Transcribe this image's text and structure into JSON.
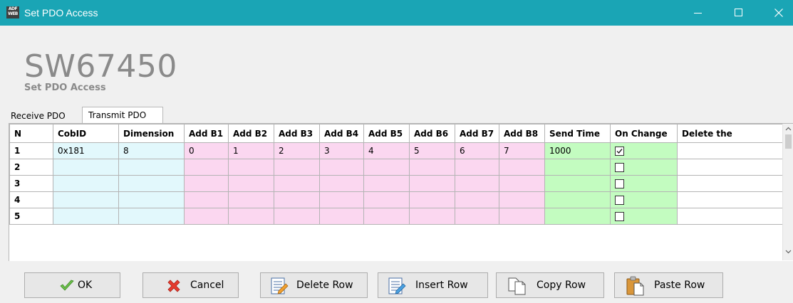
{
  "window": {
    "title": "Set PDO Access",
    "icon_text": "ADF WEB"
  },
  "header": {
    "product_code": "SW67450",
    "subtitle": "Set PDO Access"
  },
  "tabs": [
    {
      "label": "Receive PDO",
      "active": false
    },
    {
      "label": "Transmit PDO",
      "active": true
    }
  ],
  "grid": {
    "columns": [
      "N",
      "CobID",
      "Dimension",
      "Add B1",
      "Add B2",
      "Add B3",
      "Add B4",
      "Add B5",
      "Add B6",
      "Add B7",
      "Add B8",
      "Send Time",
      "On Change",
      "Delete the"
    ],
    "rows": [
      {
        "n": "1",
        "cobid": "0x181",
        "dimension": "8",
        "add": [
          "0",
          "1",
          "2",
          "3",
          "4",
          "5",
          "6",
          "7"
        ],
        "send_time": "1000",
        "on_change": true,
        "delete": ""
      },
      {
        "n": "2",
        "cobid": "",
        "dimension": "",
        "add": [
          "",
          "",
          "",
          "",
          "",
          "",
          "",
          ""
        ],
        "send_time": "",
        "on_change": false,
        "delete": ""
      },
      {
        "n": "3",
        "cobid": "",
        "dimension": "",
        "add": [
          "",
          "",
          "",
          "",
          "",
          "",
          "",
          ""
        ],
        "send_time": "",
        "on_change": false,
        "delete": ""
      },
      {
        "n": "4",
        "cobid": "",
        "dimension": "",
        "add": [
          "",
          "",
          "",
          "",
          "",
          "",
          "",
          ""
        ],
        "send_time": "",
        "on_change": false,
        "delete": ""
      },
      {
        "n": "5",
        "cobid": "",
        "dimension": "",
        "add": [
          "",
          "",
          "",
          "",
          "",
          "",
          "",
          ""
        ],
        "send_time": "",
        "on_change": false,
        "delete": ""
      }
    ]
  },
  "buttons": {
    "ok": "OK",
    "cancel": "Cancel",
    "delete_row": "Delete Row",
    "insert_row": "Insert Row",
    "copy_row": "Copy Row",
    "paste_row": "Paste Row"
  },
  "colors": {
    "titlebar": "#1aa5b5",
    "cyan_cells": "#e2f8fc",
    "pink_cells": "#fbd7f0",
    "green_cells": "#c3fcc0"
  },
  "icons": {
    "app": "adfweb-app-icon",
    "minimize": "minimize-icon",
    "maximize": "maximize-icon",
    "close": "close-icon",
    "ok": "checkmark-icon",
    "cancel": "red-x-icon",
    "delete_row": "delete-row-icon",
    "insert_row": "insert-row-icon",
    "copy_row": "copy-icon",
    "paste_row": "paste-icon"
  }
}
